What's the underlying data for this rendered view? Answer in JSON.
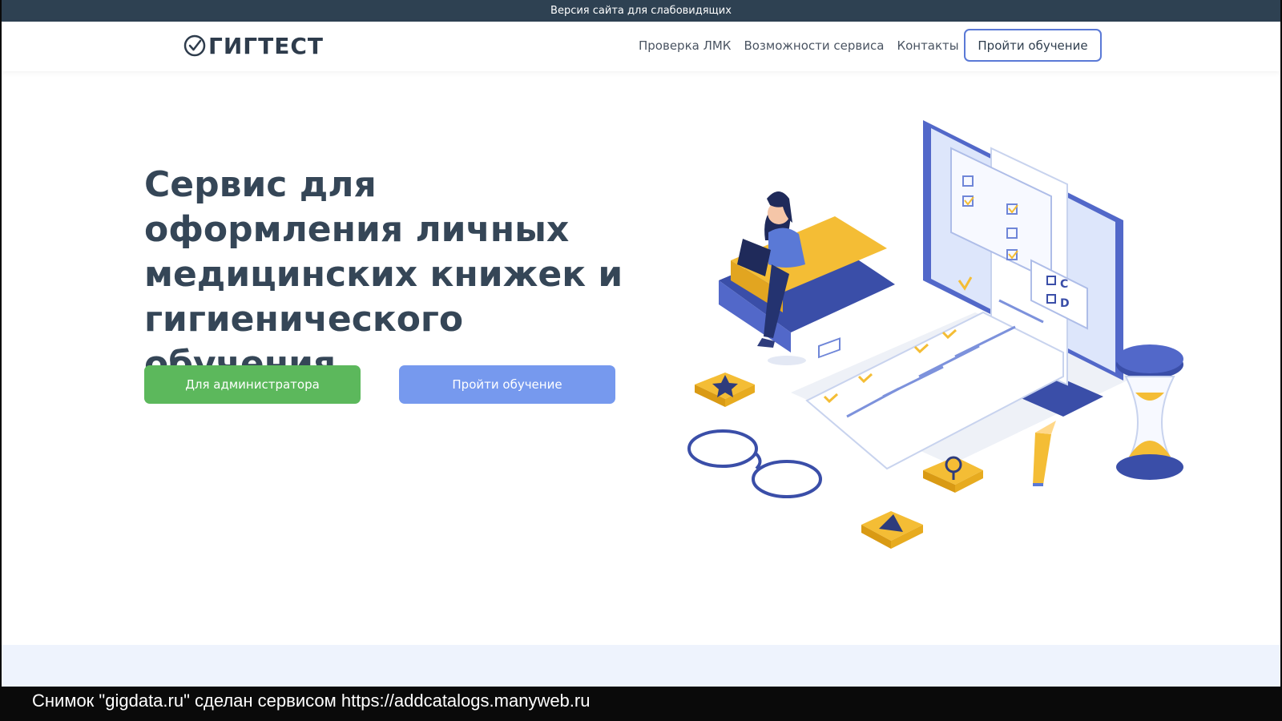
{
  "topbar": {
    "label": "Версия сайта для слабовидящих"
  },
  "header": {
    "logo_text": "ГИГТЕСТ",
    "nav": [
      {
        "label": "Проверка ЛМК"
      },
      {
        "label": "Возможности сервиса"
      },
      {
        "label": "Контакты"
      }
    ],
    "cta_label": "Пройти обучение"
  },
  "hero": {
    "title": "Сервис для оформления личных медицинских книжек и гигиенического обучения",
    "buttons": {
      "admin": "Для администратора",
      "learn": "Пройти обучение"
    },
    "illustration": {
      "options": [
        "C",
        "D"
      ]
    }
  },
  "footer": {
    "caption": "Снимок \"gigdata.ru\" сделан сервисом https://addcatalogs.manyweb.ru"
  },
  "colors": {
    "topbar": "#2e4152",
    "accent_green": "#5cb85c",
    "accent_blue": "#7699ee",
    "outline_blue": "#5a79d6",
    "title": "#354657",
    "illustration_yellow": "#f4bd35",
    "illustration_navy": "#3a4ea8"
  },
  "icons": [
    "check-circle-icon",
    "star-icon",
    "magnifier-icon",
    "play-icon",
    "glasses-icon",
    "pencil-icon",
    "hourglass-icon",
    "laptop-icon"
  ]
}
